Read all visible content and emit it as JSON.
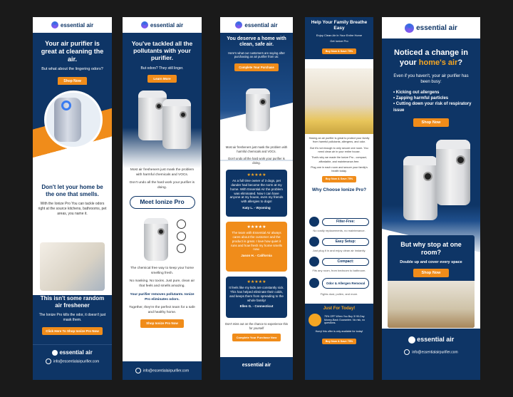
{
  "brand": "essential air",
  "colors": {
    "navy": "#0e3566",
    "orange": "#f08c1a",
    "background": "#1a1a1a",
    "gold": "#f4a623"
  },
  "email1": {
    "headline": "Your air purifier is great at cleaning the air.",
    "subhead": "But what about the lingering odors?",
    "cta1": "Shop Now",
    "h2": "Don't let your home be the one that smells.",
    "body1": "With the Ionize Pro You can tackle odors right at the source kitchens, bathrooms, pet areas, you name it.",
    "h3": "This isn't some random air freshener",
    "body2": "The Ionize Pro kills the odor, it doesn't just mask them.",
    "cta2": "Click Here To Shop Ionize Pro Now",
    "footer_email": "info@essentialairpurifier.com"
  },
  "email2": {
    "headline": "You've tackled all the pollutants with your purifier.",
    "subhead": "But odors? They still linger.",
    "cta1": "Learn More",
    "body1": "Most air fresheners just mask the problem with harmful chemicals and VOCs.",
    "body2": "Don't undo all the hard work your purifier is doing.",
    "product_title": "Meet Ionize Pro",
    "body3": "The chemical free way to keep your home smelling fresh.",
    "body4": "No masking. No toxins. Just pure, clean air that feels and smells amazing.",
    "bold1": "Your purifier removes pollutants. Ionize Pro eliminates odors.",
    "body5": "Together, they're the perfect team for a safe and healthy home.",
    "cta2": "Shop Ionize Pro Now",
    "footer_email": "info@essentialairpurifier.com"
  },
  "email3": {
    "headline": "You deserve a home with clean, safe air.",
    "subhead": "Here's what our customers are saying after purchasing an air purifier from us:",
    "cta1": "Complete Your Purchase",
    "body1": "Most air fresheners just mask the problem with harmful chemicals and VOCs.",
    "body2": "Don't undo all the hard work your purifier is doing.",
    "reviews": [
      {
        "stars": "★★★★★",
        "text": "As a full time owner of 3 dogs, pet dander had become the norm at my home. With Essential Air the problem was eliminated. Now I can have anyone at my house, even my friends with allergies to dogs!",
        "author": "Katy L. - Wyoming"
      },
      {
        "stars": "★★★★★",
        "text": "The team with Essential Air always cares about the customer and the product is great. I love how quiet it runs and how fresh my home smells now.",
        "author": "Jason H. - California"
      },
      {
        "stars": "★★★★★",
        "text": "It feels like my kids are constantly sick. This has helped eliminate their colds, and keeps them from spreading to the whole family!",
        "author": "Ellen G. - Connecticut"
      }
    ],
    "body3": "Don't miss out on the chance to experience this for yourself",
    "cta2": "Complete Your Purchase Now"
  },
  "email4": {
    "headline": "Help Your Family Breathe Easy",
    "subhead": "Enjoy Clean Air In Your Entire Home",
    "link": "Get Ionize Pro",
    "cta1": "Buy Now & Save 75%",
    "body1": "Having an air purifier is great to protect your family from harmful pollutants, allergens, and odor.",
    "body2": "But it's not enough to only secure one room. You need clean air in your entire house.",
    "body3": "That's why we made the Ionize Pro - compact, affordable, and maintenance-free.",
    "body4": "Plug one in each room and secure your family's health today.",
    "cta2": "Buy Now & Save 75%",
    "section_title": "Why Choose Ionize Pro?",
    "features": [
      {
        "label": "Filter-Free:",
        "desc": "No costly replacements, no maintenance."
      },
      {
        "label": "Easy Setup:",
        "desc": "Just plug it in and enjoy clean air instantly."
      },
      {
        "label": "Compact:",
        "desc": "Fits any room, from bedroom to bathroom."
      },
      {
        "label": "Odor & Allergen Removal",
        "desc": "Fights dust, pollen, and more."
      }
    ],
    "deal_title": "Just For Today!",
    "deal_text": "75% OFF When You Buy 3! 90-Day Money-Back Guarantee. No risk, no questions.",
    "deal_note": "Hurry! this offer is only available for today!",
    "cta3": "Buy Now & Save 75%"
  },
  "email5": {
    "headline_a": "Noticed a change in your ",
    "headline_b": "home's air",
    "headline_c": "?",
    "body1": "Even if you haven't, your air purifier has been busy:",
    "bullets": [
      "Kicking out allergens",
      "Zapping harmful particles",
      "Cutting down your risk of respiratory issue"
    ],
    "cta1": "Shop Now",
    "h2": "But why stop at one room?",
    "body2": "Double up and cover every space",
    "cta2": "Shop Now",
    "footer_email": "info@essentialairpurifier.com"
  }
}
